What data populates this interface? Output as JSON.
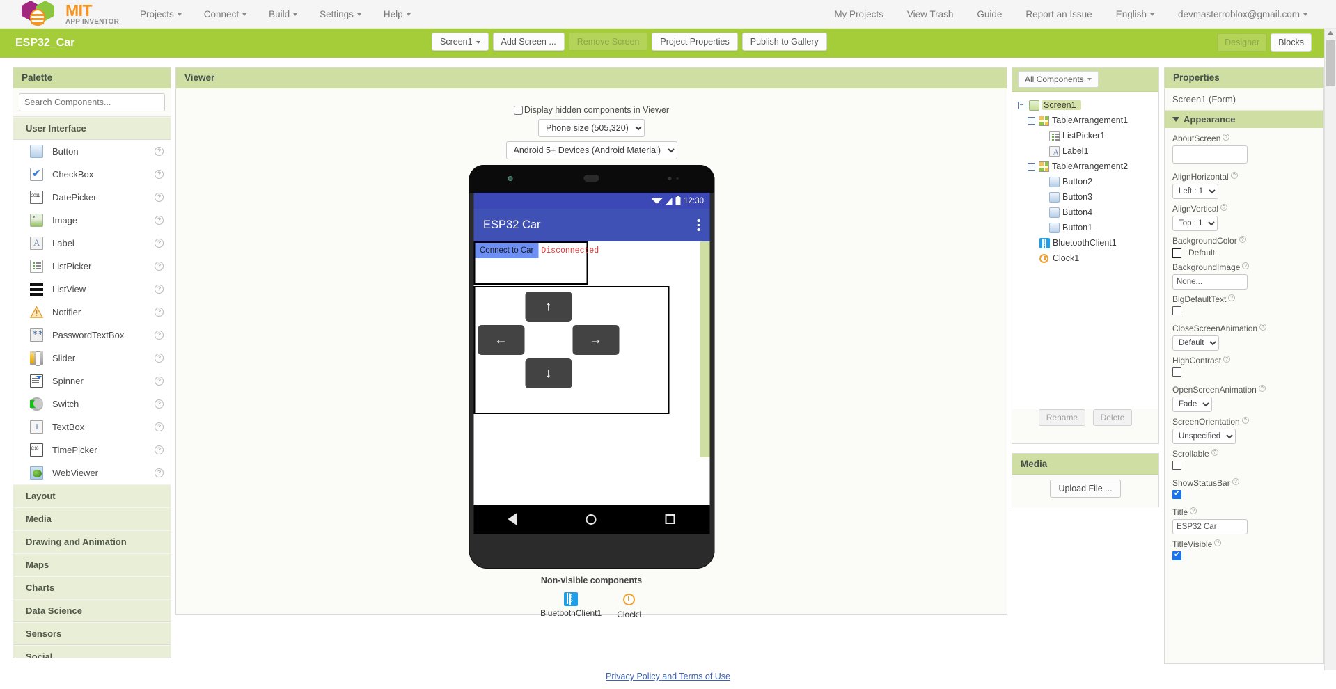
{
  "topbar": {
    "logo": {
      "mit": "MIT",
      "appinventor": "APP INVENTOR"
    },
    "menus": [
      {
        "label": "Projects",
        "icon": "chevron-down-icon"
      },
      {
        "label": "Connect",
        "icon": "chevron-down-icon"
      },
      {
        "label": "Build",
        "icon": "chevron-down-icon"
      },
      {
        "label": "Settings",
        "icon": "chevron-down-icon"
      },
      {
        "label": "Help",
        "icon": "chevron-down-icon"
      }
    ],
    "right_links": [
      {
        "label": "My Projects"
      },
      {
        "label": "View Trash"
      },
      {
        "label": "Guide"
      },
      {
        "label": "Report an Issue"
      },
      {
        "label": "English",
        "icon": "chevron-down-icon"
      },
      {
        "label": "devmasterroblox@gmail.com",
        "icon": "chevron-down-icon"
      }
    ]
  },
  "projectbar": {
    "project_name": "ESP32_Car",
    "screen_selector": "Screen1",
    "add_screen": "Add Screen ...",
    "remove_screen": "Remove Screen",
    "project_properties": "Project Properties",
    "publish_gallery": "Publish to Gallery",
    "designer": "Designer",
    "blocks": "Blocks",
    "accent_green": "#a5cd39"
  },
  "palette": {
    "title": "Palette",
    "search_placeholder": "Search Components...",
    "search_value": "",
    "open_category": "User Interface",
    "components": [
      {
        "label": "Button",
        "icon": "button-icon",
        "help": "?"
      },
      {
        "label": "CheckBox",
        "icon": "checkbox-icon",
        "help": "?"
      },
      {
        "label": "DatePicker",
        "icon": "datepicker-icon",
        "help": "?"
      },
      {
        "label": "Image",
        "icon": "image-icon",
        "help": "?"
      },
      {
        "label": "Label",
        "icon": "label-icon",
        "help": "?"
      },
      {
        "label": "ListPicker",
        "icon": "listpicker-icon",
        "help": "?"
      },
      {
        "label": "ListView",
        "icon": "listview-icon",
        "help": "?"
      },
      {
        "label": "Notifier",
        "icon": "notifier-icon",
        "help": "?"
      },
      {
        "label": "PasswordTextBox",
        "icon": "passwordtextbox-icon",
        "help": "?"
      },
      {
        "label": "Slider",
        "icon": "slider-icon",
        "help": "?"
      },
      {
        "label": "Spinner",
        "icon": "spinner-icon",
        "help": "?"
      },
      {
        "label": "Switch",
        "icon": "switch-icon",
        "help": "?"
      },
      {
        "label": "TextBox",
        "icon": "textbox-icon",
        "help": "?"
      },
      {
        "label": "TimePicker",
        "icon": "timepicker-icon",
        "help": "?"
      },
      {
        "label": "WebViewer",
        "icon": "webviewer-icon",
        "help": "?"
      }
    ],
    "categories": [
      {
        "label": "Layout"
      },
      {
        "label": "Media"
      },
      {
        "label": "Drawing and Animation"
      },
      {
        "label": "Maps"
      },
      {
        "label": "Charts"
      },
      {
        "label": "Data Science"
      },
      {
        "label": "Sensors"
      },
      {
        "label": "Social"
      }
    ]
  },
  "viewer": {
    "title": "Viewer",
    "hidden_components_label": "Display hidden components in Viewer",
    "hidden_components_checked": false,
    "phone_size": "Phone size (505,320)",
    "device_theme": "Android 5+ Devices (Android Material)",
    "phone": {
      "status_time": "12:30",
      "app_title": "ESP32 Car",
      "listpicker_text": "Connect to Car",
      "label_text": "Disconnected",
      "label_color": "#ee3333",
      "listpicker_bg": "#6d8ef2",
      "buttons": [
        {
          "name": "Button2",
          "glyph": "↑"
        },
        {
          "name": "Button3",
          "glyph": "←"
        },
        {
          "name": "Button4",
          "glyph": "→"
        },
        {
          "name": "Button1",
          "glyph": "↓"
        }
      ],
      "nav": [
        "back-icon",
        "home-icon",
        "recents-icon"
      ]
    },
    "nonvisible_title": "Non-visible components",
    "nonvisible": [
      {
        "label": "BluetoothClient1",
        "icon": "bluetooth-icon"
      },
      {
        "label": "Clock1",
        "icon": "clock-icon"
      }
    ]
  },
  "components_panel": {
    "filter_label": "All Components",
    "tree": [
      {
        "label": "Screen1",
        "depth": 0,
        "toggle": "−",
        "icon": "screen-icon",
        "selected": true
      },
      {
        "label": "TableArrangement1",
        "depth": 1,
        "toggle": "−",
        "icon": "table-arrangement-icon",
        "selected": false
      },
      {
        "label": "ListPicker1",
        "depth": 2,
        "toggle": "",
        "icon": "listpicker-icon",
        "selected": false
      },
      {
        "label": "Label1",
        "depth": 2,
        "toggle": "",
        "icon": "label-icon",
        "selected": false
      },
      {
        "label": "TableArrangement2",
        "depth": 1,
        "toggle": "−",
        "icon": "table-arrangement-icon",
        "selected": false
      },
      {
        "label": "Button2",
        "depth": 2,
        "toggle": "",
        "icon": "button-icon",
        "selected": false
      },
      {
        "label": "Button3",
        "depth": 2,
        "toggle": "",
        "icon": "button-icon",
        "selected": false
      },
      {
        "label": "Button4",
        "depth": 2,
        "toggle": "",
        "icon": "button-icon",
        "selected": false
      },
      {
        "label": "Button1",
        "depth": 2,
        "toggle": "",
        "icon": "button-icon",
        "selected": false
      },
      {
        "label": "BluetoothClient1",
        "depth": 1,
        "toggle": "",
        "icon": "bluetooth-icon",
        "selected": false
      },
      {
        "label": "Clock1",
        "depth": 1,
        "toggle": "",
        "icon": "clock-icon",
        "selected": false
      }
    ],
    "rename_label": "Rename",
    "delete_label": "Delete"
  },
  "media_panel": {
    "title": "Media",
    "upload_label": "Upload File ..."
  },
  "properties": {
    "title": "Properties",
    "subtitle": "Screen1 (Form)",
    "section": "Appearance",
    "items": [
      {
        "name": "AboutScreen",
        "type": "textarea",
        "value": ""
      },
      {
        "name": "AlignHorizontal",
        "type": "select",
        "value": "Left : 1"
      },
      {
        "name": "AlignVertical",
        "type": "select",
        "value": "Top : 1"
      },
      {
        "name": "BackgroundColor",
        "type": "color",
        "value": "Default"
      },
      {
        "name": "BackgroundImage",
        "type": "text",
        "value": "None..."
      },
      {
        "name": "BigDefaultText",
        "type": "checkbox",
        "value": false
      },
      {
        "name": "CloseScreenAnimation",
        "type": "select",
        "value": "Default"
      },
      {
        "name": "HighContrast",
        "type": "checkbox",
        "value": false
      },
      {
        "name": "OpenScreenAnimation",
        "type": "select",
        "value": "Fade"
      },
      {
        "name": "ScreenOrientation",
        "type": "select",
        "value": "Unspecified"
      },
      {
        "name": "Scrollable",
        "type": "checkbox",
        "value": false
      },
      {
        "name": "ShowStatusBar",
        "type": "checkbox",
        "value": true
      },
      {
        "name": "Title",
        "type": "text",
        "value": "ESP32 Car"
      },
      {
        "name": "TitleVisible",
        "type": "checkbox",
        "value": true
      }
    ]
  },
  "footer": {
    "link": "Privacy Policy and Terms of Use"
  }
}
